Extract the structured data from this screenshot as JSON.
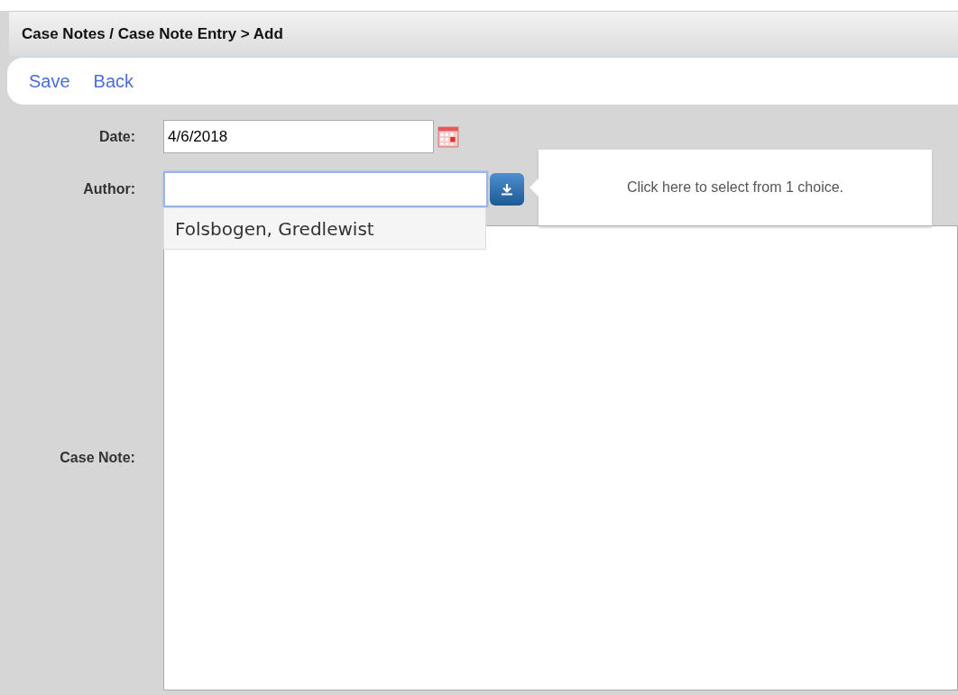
{
  "header": {
    "title": "Case Notes / Case Note Entry > Add"
  },
  "toolbar": {
    "links": [
      "Save",
      "Back"
    ]
  },
  "form": {
    "date": {
      "label": "Date:",
      "value": "4/6/2018"
    },
    "author": {
      "label": "Author:",
      "focused": true,
      "suggestions": [
        "Folsbogen, Gredlewist"
      ],
      "tooltip": "Click here to select from 1 choice."
    },
    "case_note": {
      "label": "Case Note:"
    }
  }
}
